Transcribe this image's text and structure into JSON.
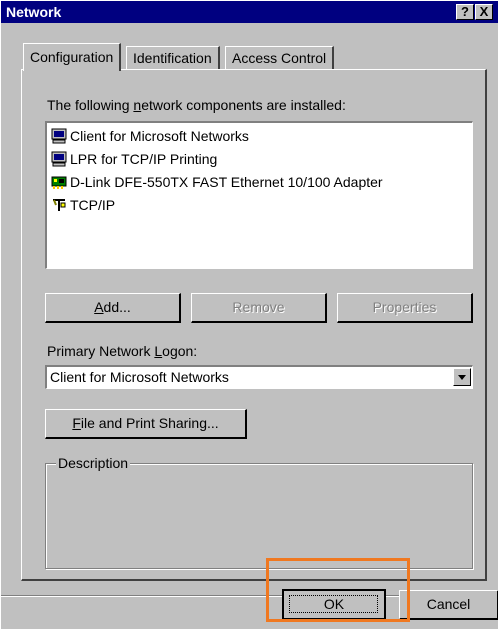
{
  "window": {
    "title": "Network",
    "help_label": "?",
    "close_label": "X"
  },
  "tabs": [
    {
      "label": "Configuration",
      "active": true
    },
    {
      "label": "Identification",
      "active": false
    },
    {
      "label": "Access Control",
      "active": false
    }
  ],
  "components": {
    "label_pre": "The following ",
    "label_accel": "n",
    "label_post": "etwork components are installed:",
    "items": [
      {
        "label": "Client for Microsoft Networks",
        "icon": "client-icon"
      },
      {
        "label": "LPR for TCP/IP Printing",
        "icon": "client-icon"
      },
      {
        "label": "D-Link DFE-550TX FAST Ethernet 10/100 Adapter",
        "icon": "network-adapter-icon"
      },
      {
        "label": "TCP/IP",
        "icon": "protocol-icon"
      }
    ]
  },
  "buttons": {
    "add_accel": "A",
    "add_rest": "dd...",
    "remove_label": "Remove",
    "properties_label": "Properties",
    "file_print_accel": "F",
    "file_print_rest": "ile and Print Sharing...",
    "ok_label": "OK",
    "cancel_label": "Cancel"
  },
  "logon": {
    "label_pre": "Primary Network ",
    "label_accel": "L",
    "label_post": "ogon:",
    "selected": "Client for Microsoft Networks"
  },
  "description": {
    "legend": "Description"
  },
  "colors": {
    "face": "#c0c0c0",
    "titlebar": "#000080",
    "highlight": "#f07820"
  }
}
